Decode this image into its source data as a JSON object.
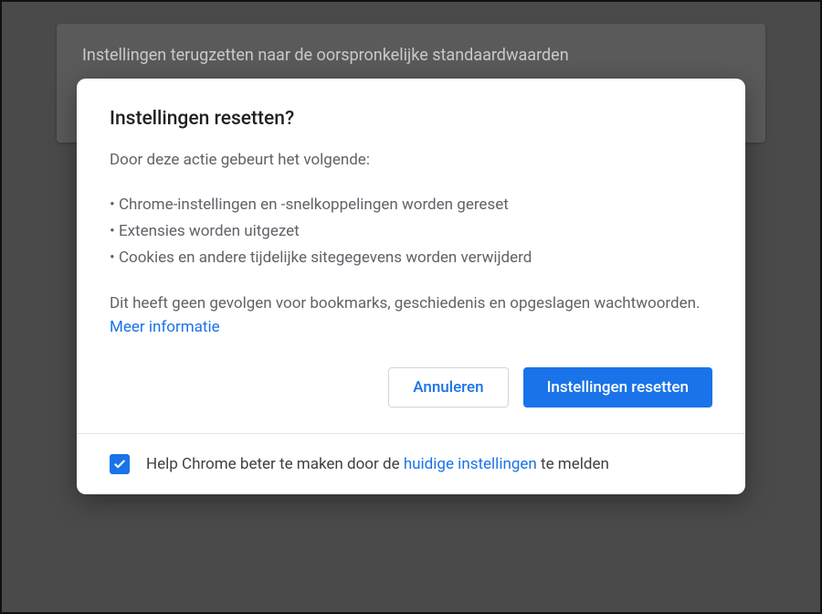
{
  "section": {
    "title": "Instellingen terugzetten naar de oorspronkelijke standaardwaarden"
  },
  "modal": {
    "title": "Instellingen resetten?",
    "intro": "Door deze actie gebeurt het volgende:",
    "bullets": [
      "Chrome-instellingen en -snelkoppelingen worden gereset",
      "Extensies worden uitgezet",
      "Cookies en andere tijdelijke sitegegevens worden verwijderd"
    ],
    "note_pre": "Dit heeft geen gevolgen voor bookmarks, geschiedenis en opgeslagen wachtwoorden. ",
    "note_link": "Meer informatie",
    "cancel_label": "Annuleren",
    "confirm_label": "Instellingen resetten"
  },
  "footer": {
    "checked": true,
    "text_pre": "Help Chrome beter te maken door de ",
    "text_link": "huidige instellingen",
    "text_post": " te melden"
  },
  "colors": {
    "primary": "#1a73e8"
  }
}
